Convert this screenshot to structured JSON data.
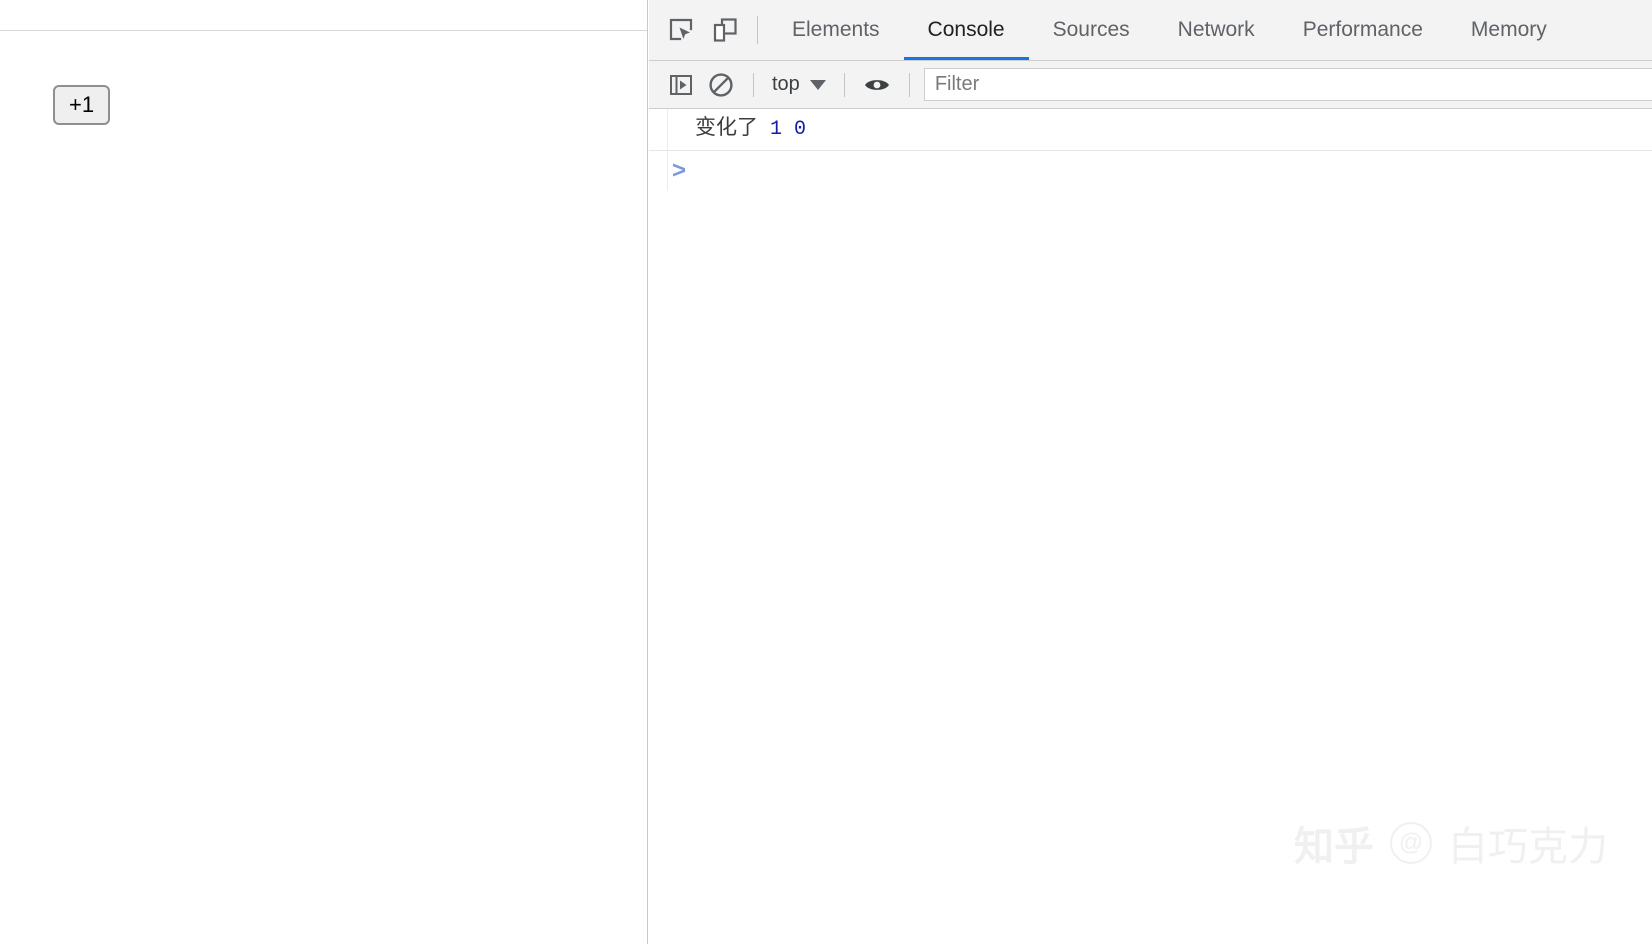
{
  "page": {
    "counter_button_label": "+1"
  },
  "devtools": {
    "toolbar_icons": [
      {
        "name": "inspect-element-icon"
      },
      {
        "name": "device-toolbar-icon"
      }
    ],
    "tabs": [
      {
        "label": "Elements",
        "active": false
      },
      {
        "label": "Console",
        "active": true
      },
      {
        "label": "Sources",
        "active": false
      },
      {
        "label": "Network",
        "active": false
      },
      {
        "label": "Performance",
        "active": false
      },
      {
        "label": "Memory",
        "active": false
      }
    ],
    "active_tab": "Console",
    "accent_color": "#1a73e8",
    "console_toolbar": {
      "sidebar_toggle_icon": "console-sidebar-icon",
      "clear_console_icon": "clear-console-icon",
      "context_selector": "top",
      "live_expression_icon": "eye-icon",
      "filter_placeholder": "Filter",
      "filter_value": ""
    },
    "console_messages": [
      {
        "text": "变化了",
        "values": [
          "1",
          "0"
        ],
        "value_color": "#1a1aa6"
      }
    ],
    "prompt_symbol": ">",
    "prompt_value": ""
  },
  "watermark": {
    "logo": "知乎",
    "at": "@",
    "user": "白巧克力"
  }
}
